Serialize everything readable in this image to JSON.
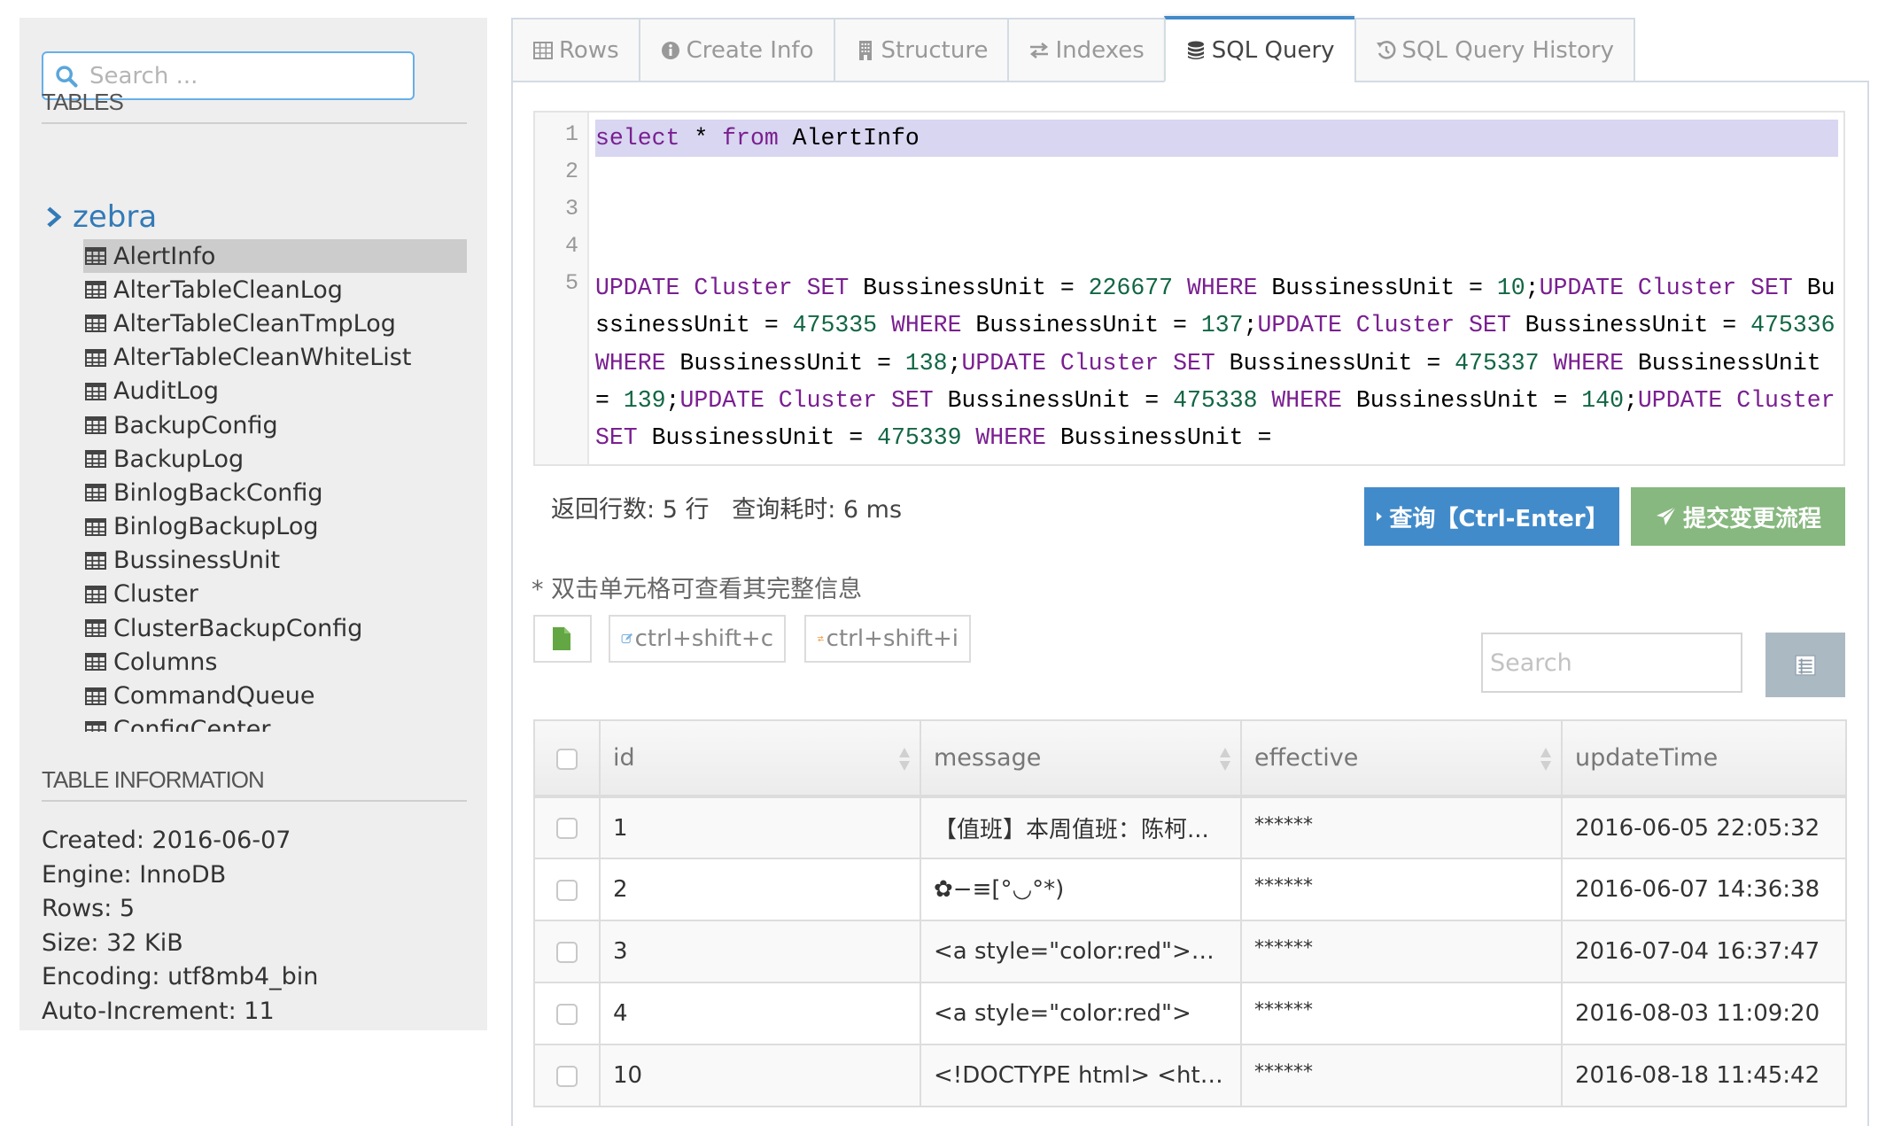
{
  "sidebar": {
    "search_placeholder": "Search ...",
    "tables_heading": "TABLES",
    "database": "zebra",
    "tables": [
      "AlertInfo",
      "AlterTableCleanLog",
      "AlterTableCleanTmpLog",
      "AlterTableCleanWhiteList",
      "AuditLog",
      "BackupConfig",
      "BackupLog",
      "BinlogBackConfig",
      "BinlogBackupLog",
      "BussinessUnit",
      "Cluster",
      "ClusterBackupConfig",
      "Columns",
      "CommandQueue",
      "ConfigCenter"
    ],
    "selected_table": "AlertInfo",
    "info_heading": "TABLE INFORMATION",
    "info": [
      "Created: 2016-06-07",
      "Engine: InnoDB",
      "Rows: 5",
      "Size: 32 KiB",
      "Encoding: utf8mb4_bin",
      "Auto-Increment: 11"
    ]
  },
  "tabs": [
    {
      "label": "Rows",
      "icon": "table-icon"
    },
    {
      "label": "Create Info",
      "icon": "info-icon"
    },
    {
      "label": "Structure",
      "icon": "building-icon"
    },
    {
      "label": "Indexes",
      "icon": "exchange-icon"
    },
    {
      "label": "SQL Query",
      "icon": "database-icon",
      "active": true
    },
    {
      "label": "SQL Query History",
      "icon": "history-icon"
    }
  ],
  "editor": {
    "line_numbers": [
      "1",
      "2",
      "3",
      "4",
      "5"
    ],
    "lines": [
      "select * from AlertInfo",
      "",
      "",
      "",
      "UPDATE Cluster SET BussinessUnit = 226677 WHERE BussinessUnit = 10;UPDATE Cluster SET BussinessUnit = 475335 WHERE BussinessUnit = 137;UPDATE Cluster SET BussinessUnit = 475336 WHERE BussinessUnit = 138;UPDATE Cluster SET BussinessUnit = 475337 WHERE BussinessUnit = 139;UPDATE Cluster SET BussinessUnit = 475338 WHERE BussinessUnit = 140;UPDATE Cluster SET BussinessUnit = 475339 WHERE BussinessUnit ="
    ],
    "keywords": [
      "select",
      "from",
      "UPDATE",
      "Cluster",
      "SET",
      "WHERE"
    ],
    "colors": {
      "keyword": "#7a1f91",
      "number": "#116644",
      "highlight": "#d8d6f0"
    }
  },
  "status": {
    "rows_label": "返回行数:",
    "rows_value": "5 行",
    "time_label": "查询耗时:",
    "time_value": "6 ms"
  },
  "buttons": {
    "query": "查询【Ctrl-Enter】",
    "submit": "提交变更流程",
    "query_color": "#428bca",
    "submit_color": "#87b87f"
  },
  "hint": "* 双击单元格可查看其完整信息",
  "toolbar": {
    "copy_label": "ctrl+shift+c",
    "insert_label": "ctrl+shift+i",
    "search_placeholder": "Search"
  },
  "grid": {
    "columns": [
      "id",
      "message",
      "effective",
      "updateTime"
    ],
    "rows": [
      {
        "id": "1",
        "message": "【值班】本周值班：陈柯...",
        "effective": "******",
        "updateTime": "2016-06-05 22:05:32"
      },
      {
        "id": "2",
        "message": "✿−≡[°◡°*)",
        "effective": "******",
        "updateTime": "2016-06-07 14:36:38"
      },
      {
        "id": "3",
        "message": "<a style=\"color:red\">ht...",
        "effective": "******",
        "updateTime": "2016-07-04 16:37:47"
      },
      {
        "id": "4",
        "message": "<a style=\"color:red\">",
        "effective": "******",
        "updateTime": "2016-08-03 11:09:20"
      },
      {
        "id": "10",
        "message": "<!DOCTYPE html> <html...",
        "effective": "******",
        "updateTime": "2016-08-18 11:45:42"
      }
    ]
  }
}
